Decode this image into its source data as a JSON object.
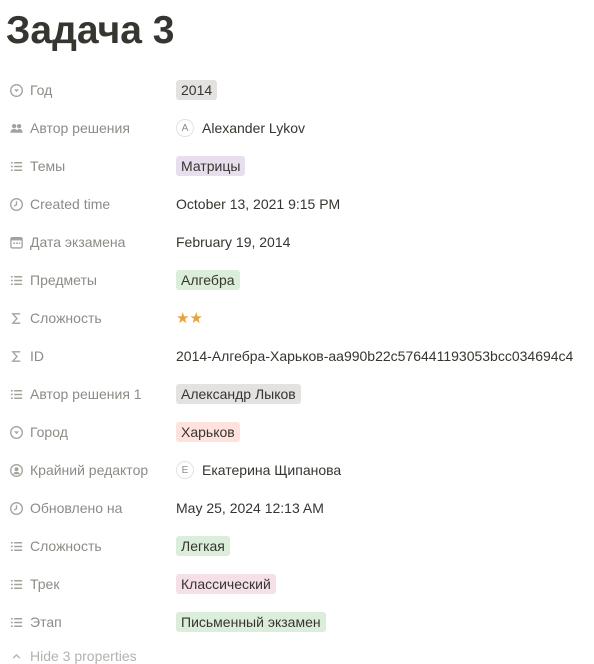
{
  "page": {
    "title": "Задача 3"
  },
  "colors": {
    "gray_tag": "#e3e2e0",
    "purple_tag": "#e8deee",
    "green_tag": "#dbeddb",
    "red_tag": "#ffe2dd",
    "pink_tag": "#f5e0e9",
    "star": "#e9a23b"
  },
  "properties": [
    {
      "label": "Год",
      "icon": "select-icon",
      "type": "tag",
      "value": "2014",
      "tag_color": "#e3e2e0"
    },
    {
      "label": "Автор решения",
      "icon": "people-icon",
      "type": "person",
      "avatar": "A",
      "value": "Alexander Lykov"
    },
    {
      "label": "Темы",
      "icon": "list-icon",
      "type": "tag",
      "value": "Матрицы",
      "tag_color": "#e8deee"
    },
    {
      "label": "Created time",
      "icon": "clock-icon",
      "type": "text",
      "value": "October 13, 2021 9:15 PM"
    },
    {
      "label": "Дата экзамена",
      "icon": "calendar-icon",
      "type": "text",
      "value": "February 19, 2014"
    },
    {
      "label": "Предметы",
      "icon": "list-icon",
      "type": "tag",
      "value": "Алгебра",
      "tag_color": "#dbeddb"
    },
    {
      "label": "Сложность",
      "icon": "formula-icon",
      "type": "stars",
      "value": "★★"
    },
    {
      "label": "ID",
      "icon": "formula-icon",
      "type": "text",
      "value": "2014-Алгебра-Харьков-aa990b22c576441193053bcc034694c4"
    },
    {
      "label": "Автор решения 1",
      "icon": "list-icon",
      "type": "tag",
      "value": "Александр Лыков",
      "tag_color": "#e3e2e0"
    },
    {
      "label": "Город",
      "icon": "select-icon",
      "type": "tag",
      "value": "Харьков",
      "tag_color": "#ffe2dd"
    },
    {
      "label": "Крайний редактор",
      "icon": "person-circle-icon",
      "type": "person",
      "avatar": "E",
      "value": "Екатерина Щипанова"
    },
    {
      "label": "Обновлено на",
      "icon": "clock-icon",
      "type": "text",
      "value": "May 25, 2024 12:13 AM"
    },
    {
      "label": "Сложность",
      "icon": "list-icon",
      "type": "tag",
      "value": "Легкая",
      "tag_color": "#dbeddb"
    },
    {
      "label": "Трек",
      "icon": "list-icon",
      "type": "tag",
      "value": "Классический",
      "tag_color": "#f5e0e9"
    },
    {
      "label": "Этап",
      "icon": "list-icon",
      "type": "tag",
      "value": "Письменный экзамен",
      "tag_color": "#dbeddb"
    }
  ],
  "footer": {
    "hide_label": "Hide 3 properties",
    "icon": "chevron-up-icon"
  }
}
